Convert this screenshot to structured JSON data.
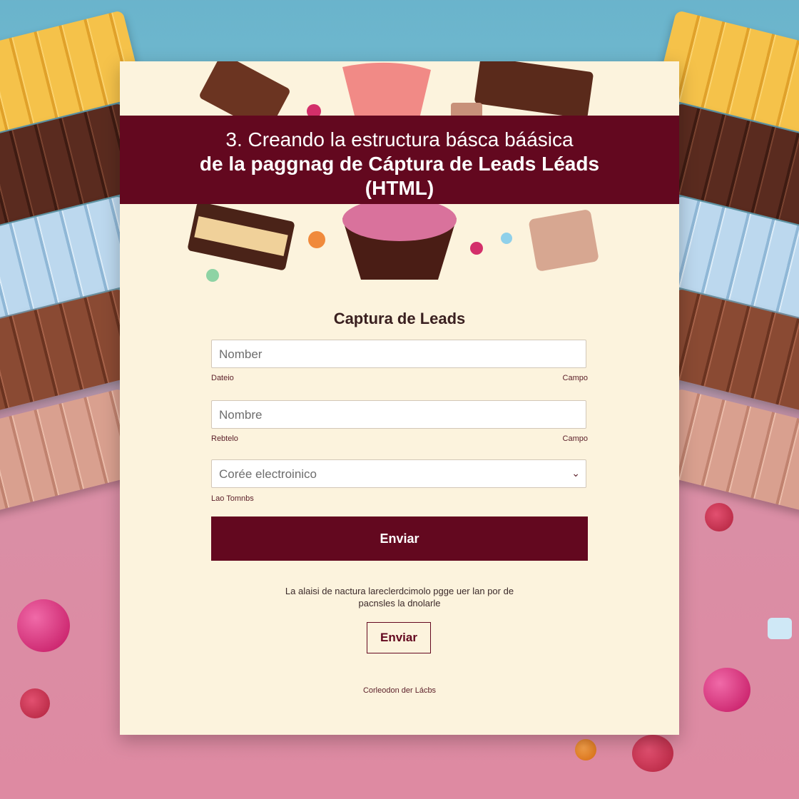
{
  "banner": {
    "line1": "3. Creando la estructura básca báásica",
    "line2": "de la paggnag de Cáptura de Leads Léads",
    "line3": "(HTML)"
  },
  "form": {
    "title": "Captura de Leads",
    "fields": [
      {
        "value": "Nomber",
        "hint_left": "Dateio",
        "hint_right": "Campo"
      },
      {
        "value": "Nombre",
        "hint_left": "Rebtelo",
        "hint_right": "Campo"
      },
      {
        "value": "Corée electroinico",
        "hint_left": "Lao Tomnbs"
      }
    ],
    "submit_label": "Enviar",
    "note_line1": "La alaisi de nactura lareclerdcimolo pgge uer lan por de",
    "note_line2": "pacnsles la dnolarle",
    "secondary_label": "Enviar",
    "footer": "Corleodon der Lácbs"
  },
  "colors": {
    "brand": "#63081f",
    "card": "#fcf3dd"
  }
}
